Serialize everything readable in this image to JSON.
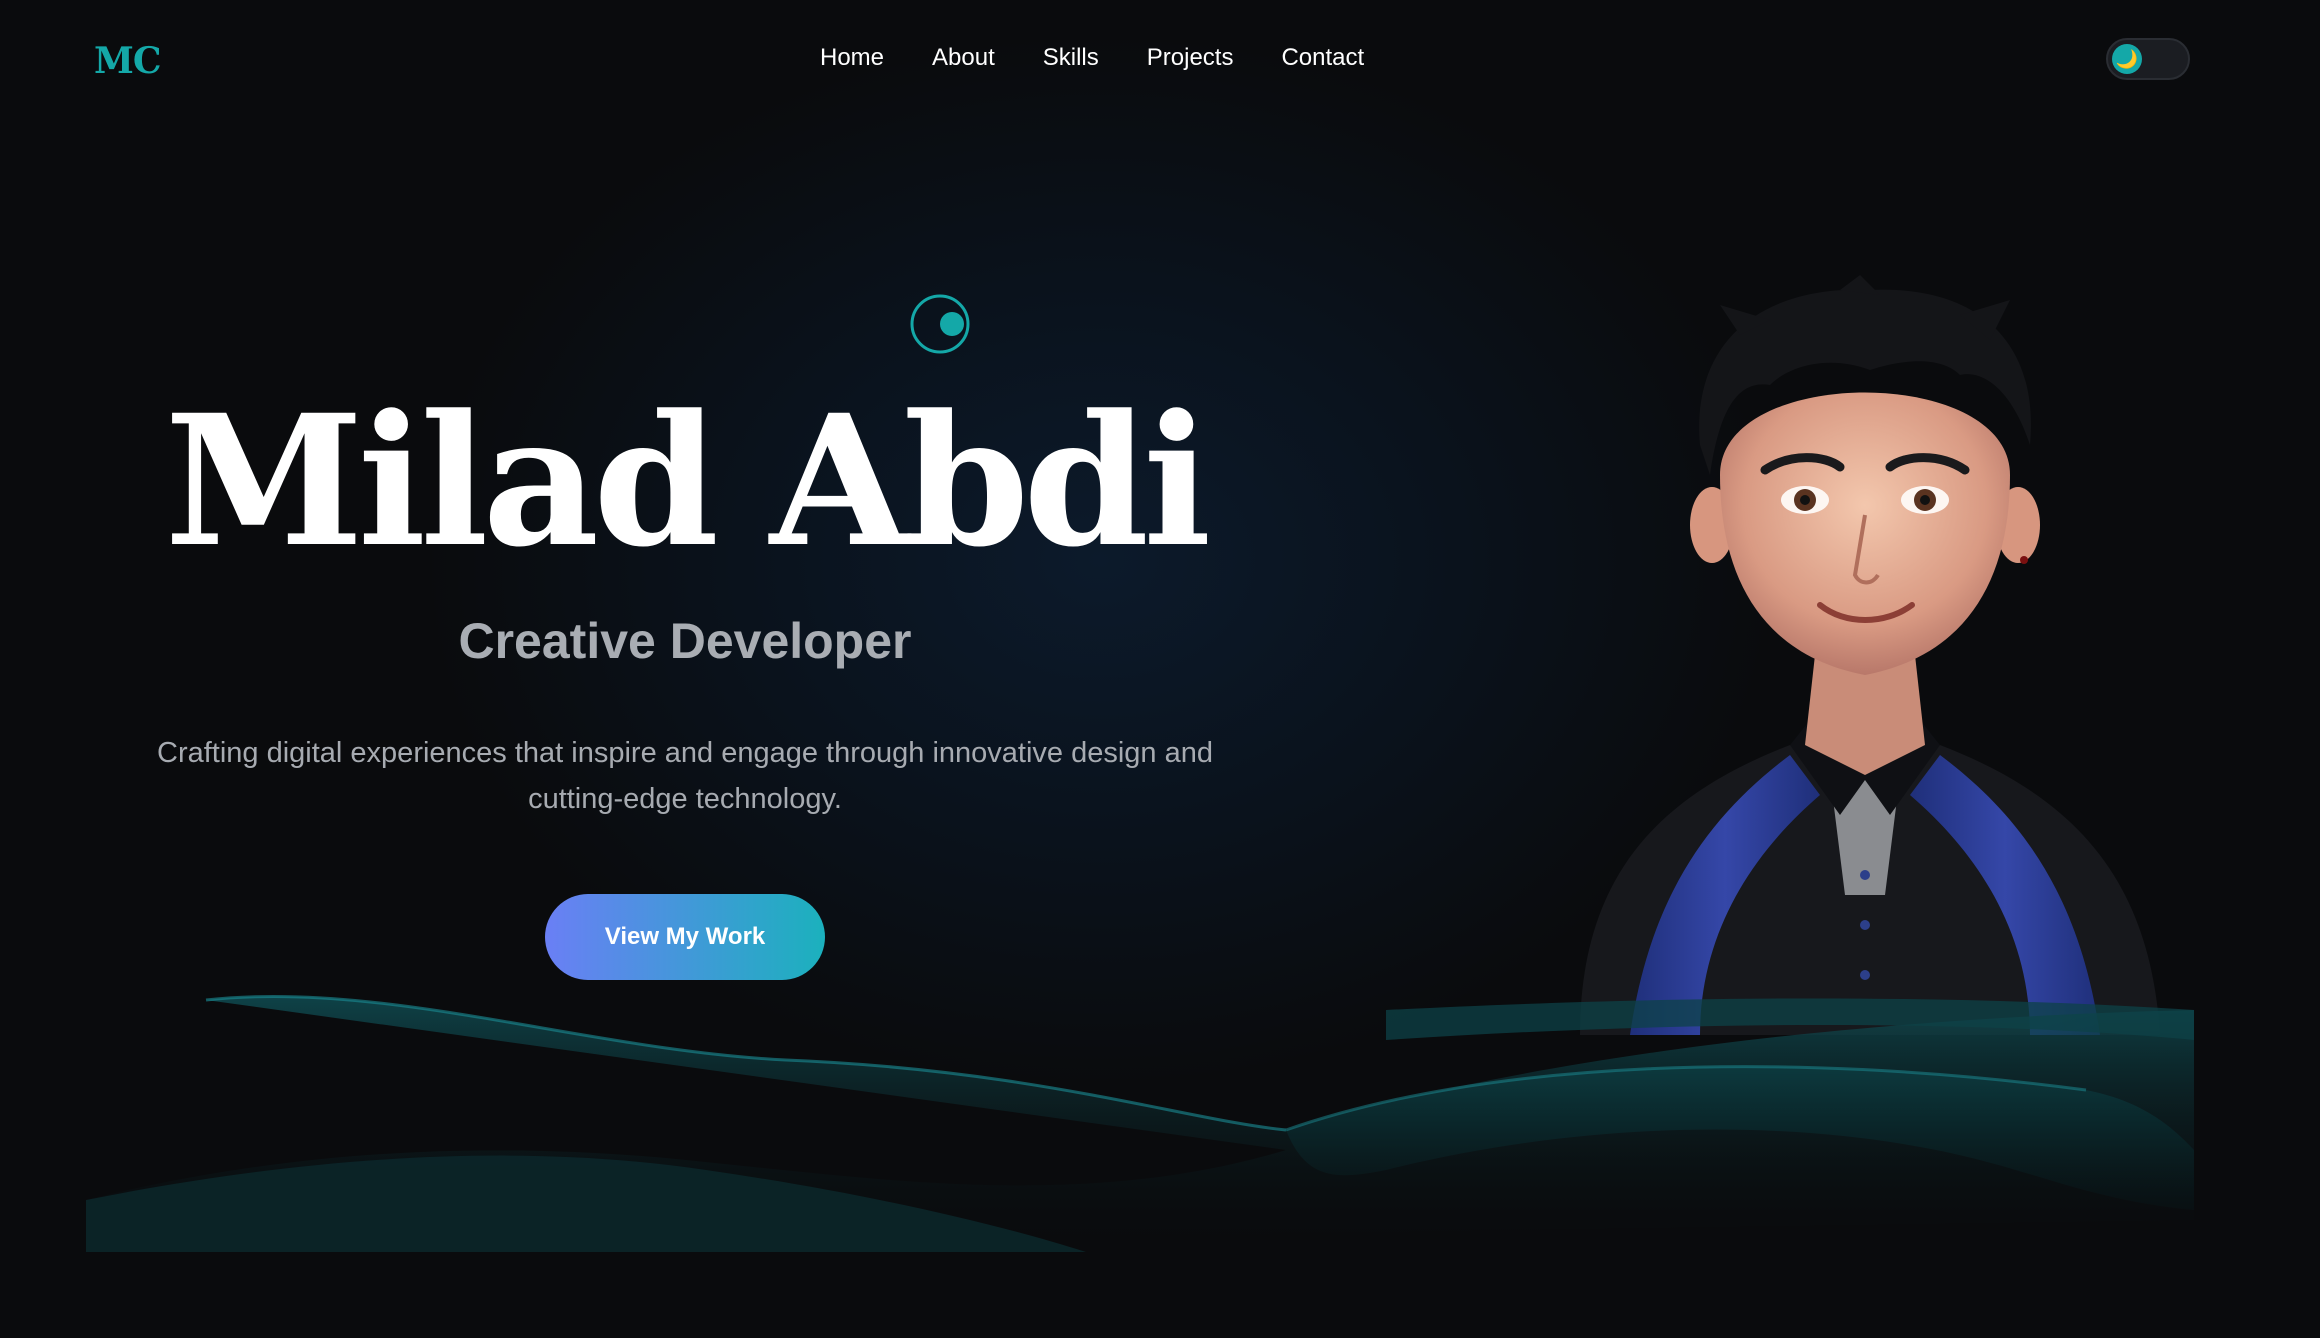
{
  "header": {
    "logo": "MC",
    "nav": [
      "Home",
      "About",
      "Skills",
      "Projects",
      "Contact"
    ],
    "theme_toggle_icon": "🌙"
  },
  "hero": {
    "name": "Milad Abdi",
    "role": "Creative Developer",
    "tagline_line1": "Crafting digital experiences that inspire and engage through innovative design and",
    "tagline_line2": "cutting-edge technology.",
    "cta_label": "View My Work"
  },
  "colors": {
    "accent": "#14a8a8",
    "background": "#0a0a0b",
    "cta_gradient_start": "#6a7ff5",
    "cta_gradient_end": "#1bb1bd"
  },
  "icons": {
    "orbit": "orbit-icon",
    "moon": "moon-icon"
  }
}
